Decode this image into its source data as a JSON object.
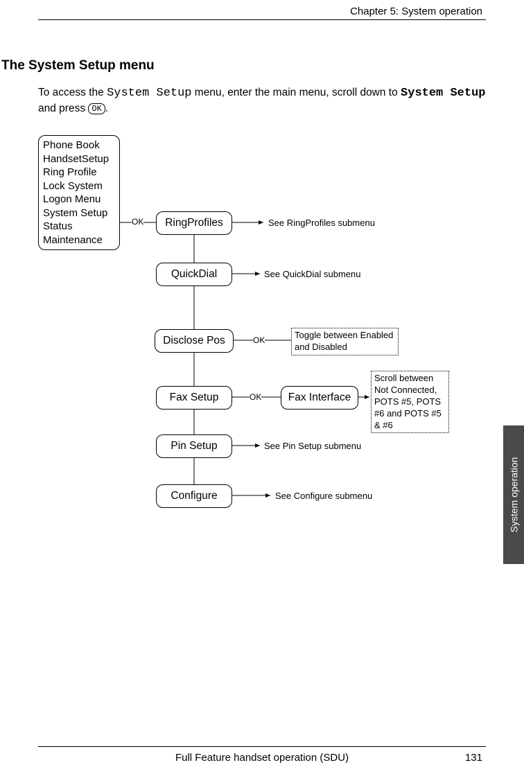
{
  "header": {
    "chapter": "Chapter 5:  System operation"
  },
  "section_title": "The System Setup menu",
  "intro": {
    "pre": "To access the ",
    "mono1": "System Setup",
    "mid": " menu, enter the main menu, scroll down to ",
    "mono2": "System Setup",
    "post": " and press ",
    "ok": "OK",
    "end": "."
  },
  "main_menu_items": [
    "Phone Book",
    "HandsetSetup",
    "Ring Profile",
    "Lock System",
    "Logon Menu",
    "System Setup",
    "Status",
    "Maintenance"
  ],
  "ok_label": "OK",
  "nodes": {
    "ringprofiles": "RingProfiles",
    "quickdial": "QuickDial",
    "disclose": "Disclose Pos",
    "fax": "Fax Setup",
    "faxif": "Fax Interface",
    "pin": "Pin Setup",
    "configure": "Configure"
  },
  "notes": {
    "ringprofiles": "See RingProfiles submenu",
    "quickdial": "See QuickDial submenu",
    "pin": "See Pin Setup submenu",
    "configure": "See Configure submenu"
  },
  "dashed": {
    "disclose": "Toggle between Enabled and Disabled",
    "fax": "Scroll between Not Connected, POTS #5, POTS #6 and POTS #5 & #6"
  },
  "side_tab": "System operation",
  "footer": {
    "text": "Full Feature handset operation (SDU)",
    "page": "131"
  }
}
